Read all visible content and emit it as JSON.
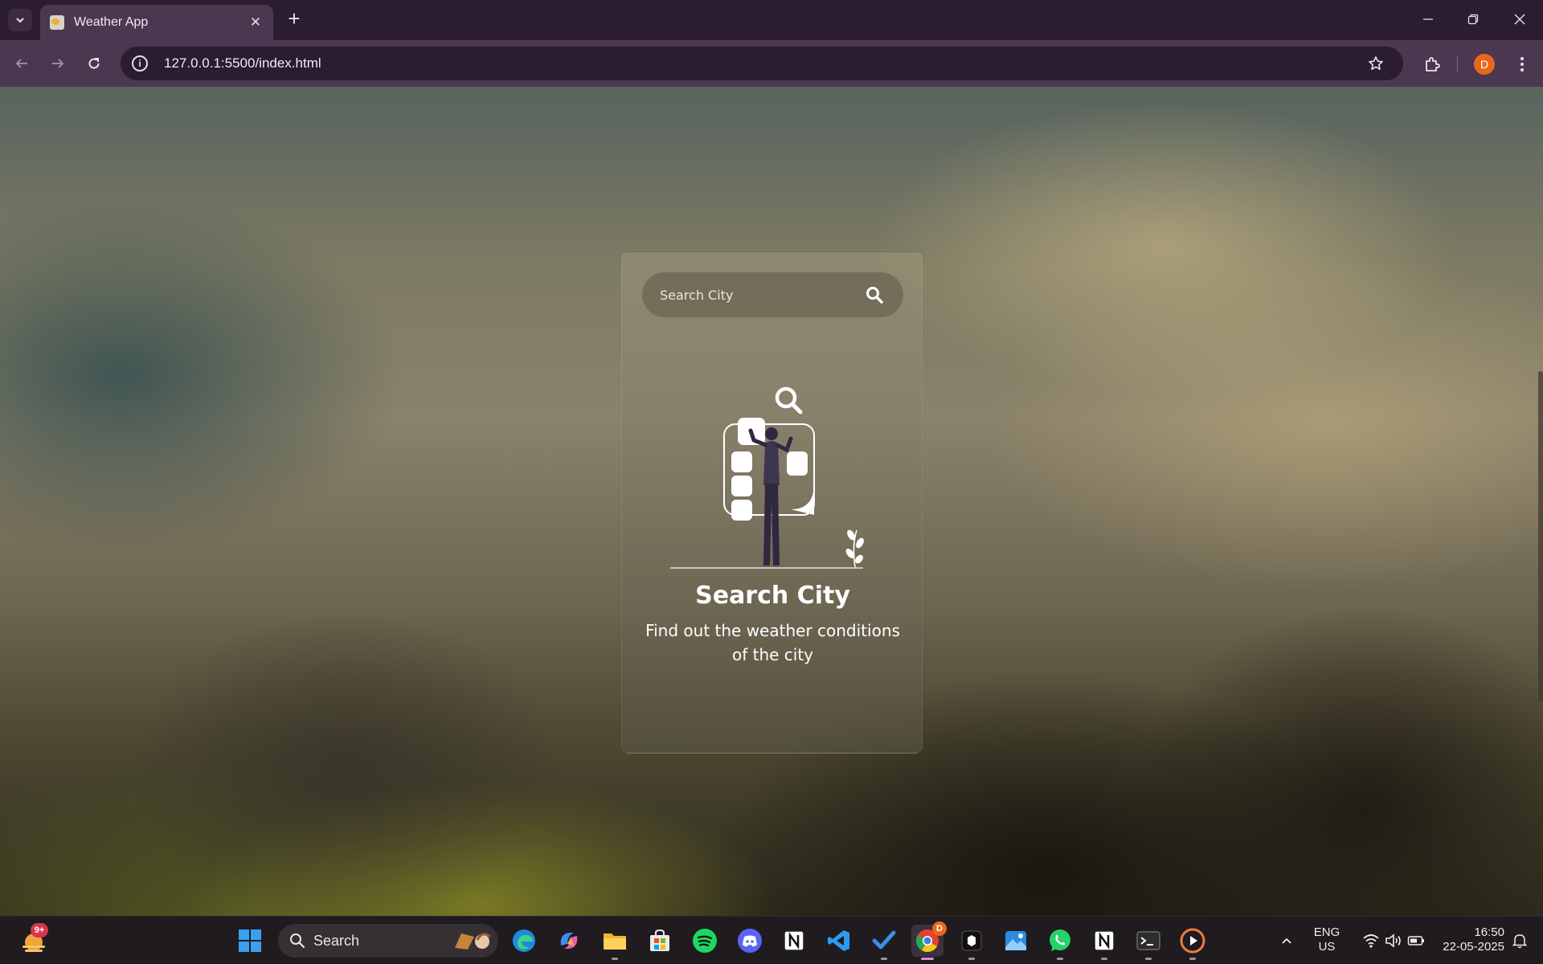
{
  "browser": {
    "tab_title": "Weather App",
    "url": "127.0.0.1:5500/index.html",
    "profile_initial": "D"
  },
  "card": {
    "search_placeholder": "Search City",
    "title": "Search City",
    "subtitle": "Find out the weather conditions of the city"
  },
  "taskbar": {
    "widget_badge": "9+",
    "search_label": "Search",
    "chrome_badge": "D",
    "language_line1": "ENG",
    "language_line2": "US",
    "time": "16:50",
    "date": "22-05-2025"
  },
  "colors": {
    "tabbar_bg": "#2b1c2f",
    "toolbar_bg": "#4b3750",
    "profile_accent": "#e8681a",
    "taskbar_bg": "#1f1b1f"
  },
  "icons": [
    "tab-list-chevron-icon",
    "favicon-icon",
    "close-icon",
    "plus-icon",
    "minimize-icon",
    "restore-icon",
    "back-arrow-icon",
    "forward-arrow-icon",
    "reload-icon",
    "info-icon",
    "star-icon",
    "extensions-icon",
    "kebab-menu-icon",
    "search-icon",
    "windows-start-icon",
    "edge-icon",
    "copilot-icon",
    "file-explorer-icon",
    "store-icon",
    "spotify-icon",
    "discord-icon",
    "notion-icon",
    "vscode-icon",
    "todo-icon",
    "chrome-icon",
    "app-icon",
    "photos-icon",
    "whatsapp-icon",
    "terminal-icon",
    "media-player-icon",
    "wifi-icon",
    "volume-icon",
    "battery-icon",
    "notification-icon"
  ]
}
